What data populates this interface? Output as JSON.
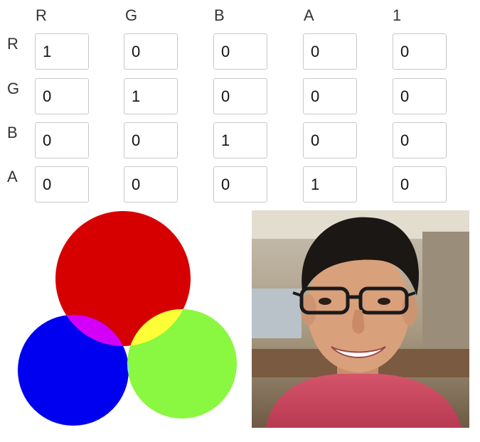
{
  "matrix": {
    "columns": [
      "R",
      "G",
      "B",
      "A",
      "1"
    ],
    "rows": [
      {
        "label": "R",
        "values": [
          "1",
          "0",
          "0",
          "0",
          "0"
        ]
      },
      {
        "label": "G",
        "values": [
          "0",
          "1",
          "0",
          "0",
          "0"
        ]
      },
      {
        "label": "B",
        "values": [
          "0",
          "0",
          "1",
          "0",
          "0"
        ]
      },
      {
        "label": "A",
        "values": [
          "0",
          "0",
          "0",
          "1",
          "0"
        ]
      }
    ]
  },
  "venn": {
    "red": "#d60000",
    "green": "#8af740",
    "blue": "#0000f0",
    "magenta": "#d200f8",
    "yellow": "#ffff38",
    "cyan": "#88faff",
    "white": "#ffffff"
  }
}
